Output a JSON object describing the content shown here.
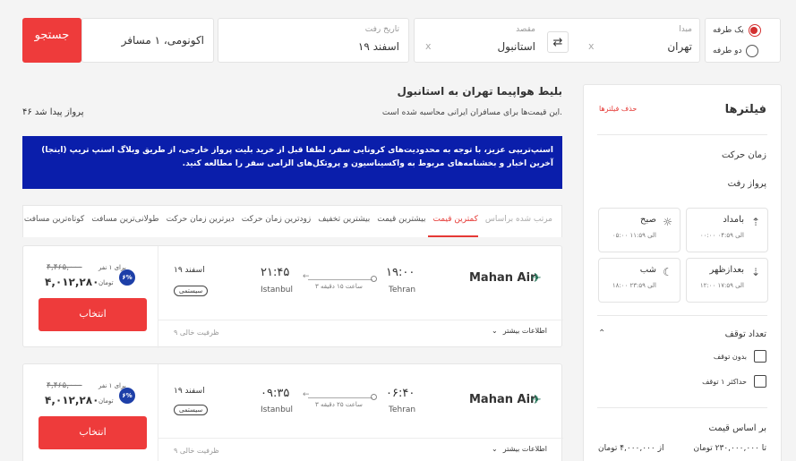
{
  "search": {
    "trip_types": [
      {
        "label": "یک طرفه",
        "selected": true
      },
      {
        "label": "دو طرفه",
        "selected": false
      }
    ],
    "origin": {
      "label": "مبدا",
      "value": "تهران"
    },
    "destination": {
      "label": "مقصد",
      "value": "استانبول"
    },
    "date": {
      "label": "تاریخ رفت",
      "value": "۱۹ اسفند"
    },
    "passengers": "اکونومی، ۱ مسافر",
    "search_label": "جستجو",
    "clear": "x"
  },
  "filters": {
    "title": "فیلترها",
    "clear_label": "حذف فیلترها",
    "departure_time_title": "زمان حرکت",
    "outbound_label": "پرواز رفت",
    "time_slots": [
      {
        "name": "بامداد",
        "range": "۰۰:۰۰ الی ۰۴:۵۹",
        "icon": "sunrise-icon"
      },
      {
        "name": "صبح",
        "range": "۰۵:۰۰ الی ۱۱:۵۹",
        "icon": "sun-icon"
      },
      {
        "name": "بعدازظهر",
        "range": "۱۲:۰۰ الی ۱۷:۵۹",
        "icon": "sunset-icon"
      },
      {
        "name": "شب",
        "range": "۱۸:۰۰ الی ۲۳:۵۹",
        "icon": "moon-icon"
      }
    ],
    "stops_title": "تعداد توقف",
    "stops": [
      "بدون توقف",
      "حداکثر ۱ توقف"
    ],
    "price_title": "بر اساس قیمت",
    "price_from": "از ۴,۰۰۰,۰۰۰ تومان",
    "price_to": "تا ۲۳۰,۰۰۰,۰۰۰ تومان"
  },
  "results": {
    "title": "بلیط هواپیما تهران به استانبول",
    "subtitle": "این قیمت‌ها برای مسافران ایرانی محاسبه شده است.",
    "count": "۴۶ پرواز پیدا شد",
    "notice": "اسنپ‌تریپی عزیز، با توجه به محدودیت‌های کرونایی سفر، لطفا قبل از خرید بلیت پرواز خارجی، از طریق وبلاگ اسنپ تریپ (اینجا) آخرین اخبار و بخشنامه‌های مربوط به واکسیناسیون و پروتکل‌های الزامی سفر را مطالعه کنید.",
    "sort_label": "مرتب شده براساس",
    "sort_options": [
      "کمترین قیمت",
      "بیشترین قیمت",
      "بیشترین تخفیف",
      "زودترین زمان حرکت",
      "دیرترین زمان حرکت",
      "طولانی‌ترین مسافت",
      "کوتاه‌ترین مسافت"
    ],
    "flights": [
      {
        "airline": "Mahan Air",
        "dep_time": "۱۹:۰۰",
        "dep_city": "Tehran",
        "arr_time": "۲۱:۴۵",
        "arr_city": "Istanbul",
        "duration": "۳ ساعت ۱۵ دقیقه",
        "date": "۱۹ اسفند",
        "class": "سیستمی",
        "old_price": "۴,۴۶۵,۰۰۰",
        "price": "۴,۰۱۲,۲۸۰",
        "per": "برای ۱ نفر",
        "currency": "تومان",
        "discount": "۶%",
        "select": "انتخاب",
        "more_info": "اطلاعات بیشتر",
        "capacity": "ظرفیت خالی ۹"
      },
      {
        "airline": "Mahan Air",
        "dep_time": "۰۶:۴۰",
        "dep_city": "Tehran",
        "arr_time": "۰۹:۳۵",
        "arr_city": "Istanbul",
        "duration": "۳ ساعت ۲۵ دقیقه",
        "date": "۱۹ اسفند",
        "class": "سیستمی",
        "old_price": "۴,۴۶۵,۰۰۰",
        "price": "۴,۰۱۲,۲۸۰",
        "per": "برای ۱ نفر",
        "currency": "تومان",
        "discount": "۶%",
        "select": "انتخاب",
        "more_info": "اطلاعات بیشتر",
        "capacity": "ظرفیت خالی ۹"
      }
    ]
  },
  "colors": {
    "accent": "#ee3b3b",
    "notice_bg": "#0a1eab",
    "discount": "#1d3fa8"
  }
}
